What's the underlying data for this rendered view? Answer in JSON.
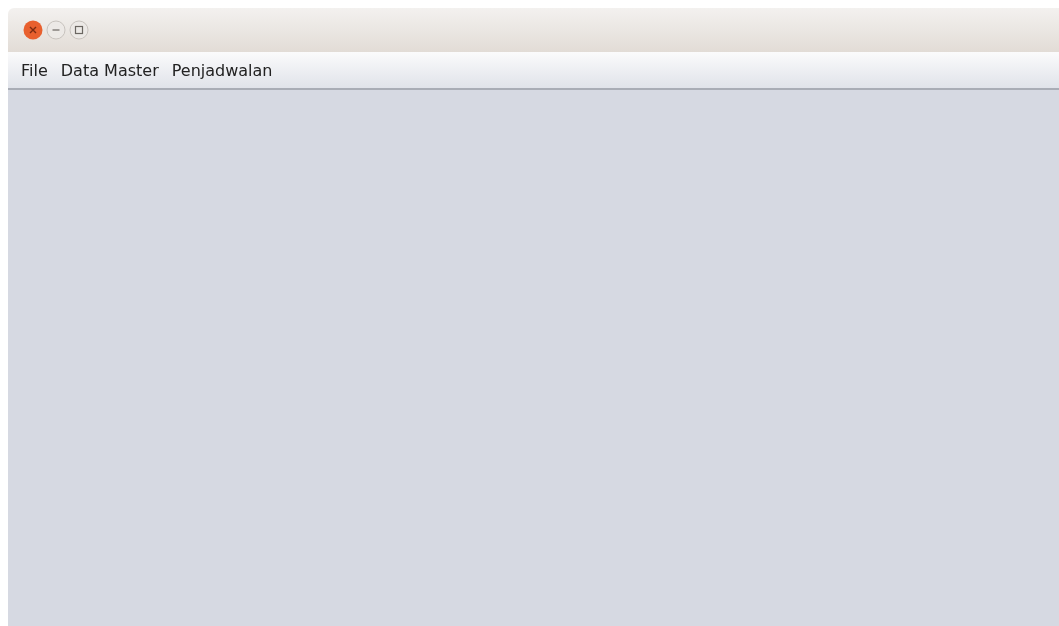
{
  "menu_bar": {
    "items": [
      {
        "label": "File"
      },
      {
        "label": "Data Master"
      },
      {
        "label": "Penjadwalan"
      }
    ]
  }
}
